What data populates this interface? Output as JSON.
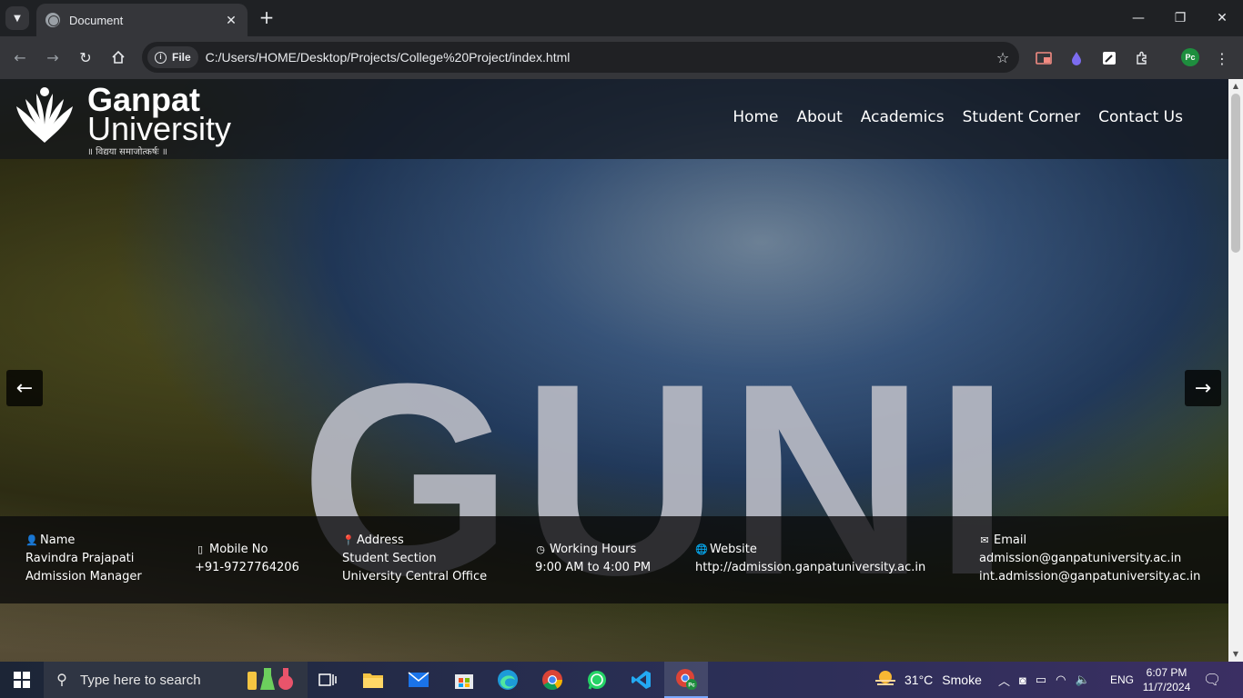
{
  "browser": {
    "tab_title": "Document",
    "tab_close": "✕",
    "new_tab": "+",
    "chip_label": "File",
    "url": "C:/Users/HOME/Desktop/Projects/College%20Project/index.html",
    "profile_initials": "Pc"
  },
  "site": {
    "logo_line1": "Ganpat",
    "logo_line2": "University",
    "logo_motto": "॥ विद्यया समाजोत्कर्षः ॥",
    "nav": [
      "Home",
      "About",
      "Academics",
      "Student Corner",
      "Contact Us"
    ],
    "hero_text": "GUNI",
    "prev_arrow": "←",
    "next_arrow": "→"
  },
  "contact": {
    "name": {
      "heading": "Name",
      "line1": "Ravindra Prajapati",
      "line2": "Admission Manager",
      "icon": "user-icon"
    },
    "mobile": {
      "heading": "Mobile No",
      "line1": "+91-9727764206",
      "icon": "mobile-icon"
    },
    "address": {
      "heading": "Address",
      "line1": "Student Section",
      "line2": "University Central Office",
      "icon": "map-marker-icon"
    },
    "hours": {
      "heading": "Working Hours",
      "line1": "9:00 AM to 4:00 PM",
      "icon": "clock-icon"
    },
    "website": {
      "heading": "Website",
      "line1": "http://admission.ganpatuniversity.ac.in",
      "icon": "globe-icon"
    },
    "email": {
      "heading": "Email",
      "line1": "admission@ganpatuniversity.ac.in",
      "line2": "int.admission@ganpatuniversity.ac.in",
      "icon": "envelope-icon"
    }
  },
  "taskbar": {
    "search_placeholder": "Type here to search",
    "weather_temp": "31°C",
    "weather_desc": "Smoke",
    "language": "ENG",
    "time": "6:07 PM",
    "date": "11/7/2024"
  }
}
